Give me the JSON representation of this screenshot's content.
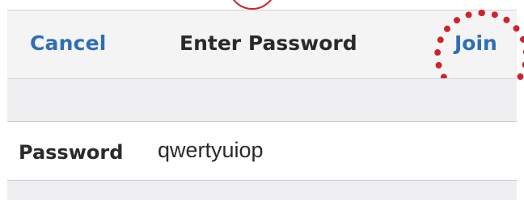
{
  "navbar": {
    "cancel_label": "Cancel",
    "title": "Enter Password",
    "join_label": "Join"
  },
  "form": {
    "password_label": "Password",
    "password_value": "qwertyuiop"
  },
  "colors": {
    "accent": "#2f6eb5",
    "highlight": "#d0222e",
    "group_background": "#efeff2"
  }
}
